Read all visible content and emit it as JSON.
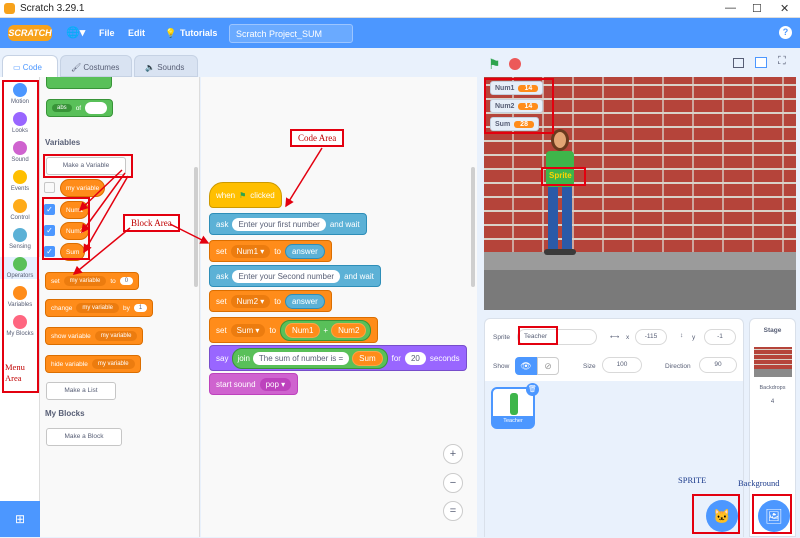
{
  "window": {
    "title": "Scratch 3.29.1",
    "minimize": "—",
    "maximize": "☐",
    "close": "✕"
  },
  "menu": {
    "logo": "SCRATCH",
    "file": "File",
    "edit": "Edit",
    "tutorials": "Tutorials",
    "project_name": "Scratch Project_SUM",
    "help": "?"
  },
  "tabs": {
    "code": "Code",
    "costumes": "Costumes",
    "sounds": "Sounds"
  },
  "categories": [
    {
      "label": "Motion",
      "color": "#4c97ff"
    },
    {
      "label": "Looks",
      "color": "#9966ff"
    },
    {
      "label": "Sound",
      "color": "#cf63cf"
    },
    {
      "label": "Events",
      "color": "#ffbf00"
    },
    {
      "label": "Control",
      "color": "#ffab19"
    },
    {
      "label": "Sensing",
      "color": "#5cb1d6"
    },
    {
      "label": "Operators",
      "color": "#59c059"
    },
    {
      "label": "Variables",
      "color": "#ff8c1a"
    },
    {
      "label": "My Blocks",
      "color": "#ff6680"
    }
  ],
  "palette": {
    "abs": "abs",
    "of": "of",
    "variables_heading": "Variables",
    "make_variable": "Make a Variable",
    "vars": [
      "my variable",
      "Num1",
      "Num2",
      "Sum"
    ],
    "set": "set",
    "set_var": "my variable",
    "to": "to",
    "set_val": "0",
    "change": "change",
    "change_var": "my variable",
    "by": "by",
    "change_val": "1",
    "show": "show variable",
    "show_var": "my variable",
    "hide": "hide variable",
    "hide_var": "my variable",
    "make_list": "Make a List",
    "myblocks_heading": "My Blocks",
    "make_block": "Make a Block"
  },
  "script": {
    "when": "when",
    "clicked": "clicked",
    "ask1": "ask",
    "ask1_text": "Enter your first number",
    "and_wait1": "and wait",
    "set1": "set",
    "set1_var": "Num1",
    "to1": "to",
    "answer1": "answer",
    "ask2": "ask",
    "ask2_text": "Enter your Second number",
    "and_wait2": "and wait",
    "set2": "set",
    "set2_var": "Num2",
    "to2": "to",
    "answer2": "answer",
    "set3": "set",
    "set3_var": "Sum",
    "to3": "to",
    "plus_a": "Num1",
    "plus": "+",
    "plus_b": "Num2",
    "say": "say",
    "join": "join",
    "join_text": "The sum of number is =",
    "join_var": "Sum",
    "for": "for",
    "secs": "20",
    "seconds": "seconds",
    "start_sound": "start sound",
    "sound": "pop"
  },
  "annotations": {
    "code_area": "Code Area",
    "block_area": "Block Area",
    "menu_area": "Menu\nArea",
    "sprite": "SPRITE",
    "background": "Background",
    "sprite_label": "Sprite"
  },
  "stage": {
    "monitors": [
      {
        "name": "Num1",
        "value": "14"
      },
      {
        "name": "Num2",
        "value": "14"
      },
      {
        "name": "Sum",
        "value": "28"
      }
    ]
  },
  "sprite_info": {
    "sprite_label": "Sprite",
    "sprite_name": "Teacher",
    "x_label": "x",
    "x": "-115",
    "y_label": "y",
    "y": "-1",
    "show": "Show",
    "size_label": "Size",
    "size": "100",
    "direction_label": "Direction",
    "direction": "90",
    "thumb_name": "Teacher"
  },
  "stage_pane": {
    "title": "Stage",
    "backdrops_label": "Backdrops",
    "backdrops": "4"
  },
  "zoom": {
    "in": "+",
    "out": "−",
    "reset": "="
  }
}
